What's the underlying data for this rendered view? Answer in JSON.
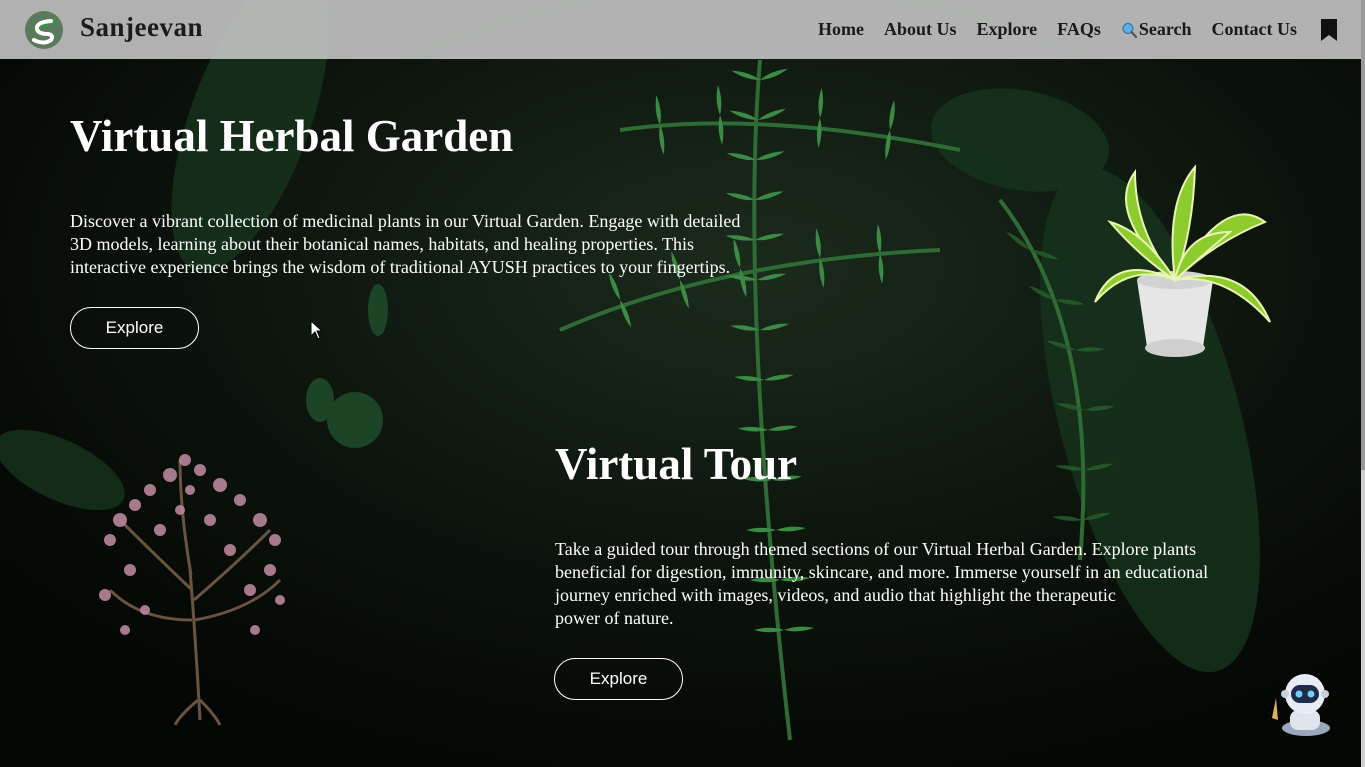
{
  "brand": {
    "name": "Sanjeevan",
    "logo_icon": "leaf-s-logo-icon"
  },
  "nav": {
    "home": "Home",
    "about": "About Us",
    "explore": "Explore",
    "faqs": "FAQs",
    "search": "Search",
    "contact": "Contact Us",
    "bookmark_icon": "bookmark-icon"
  },
  "hero": {
    "title": "Virtual Herbal Garden",
    "line1": "Discover a vibrant collection of medicinal plants in our Virtual Garden. Engage with detailed",
    "line2": "3D models, learning about their botanical names, habitats, and healing properties. This",
    "line3": "interactive experience brings the wisdom of traditional AYUSH practices to your fingertips.",
    "button": "Explore"
  },
  "tour": {
    "title": "Virtual Tour",
    "line1": "Take a guided tour through themed sections of our Virtual Herbal Garden. Explore plants",
    "line2": "beneficial for digestion, immunity, skincare, and more. Immerse yourself in an educational",
    "line3": "journey enriched with images, videos, and audio that highlight the therapeutic",
    "line4": "power of nature.",
    "button": "Explore"
  },
  "colors": {
    "navbar": "#cdcdcd",
    "background": "#060806",
    "fern": "#2f7a3a",
    "text": "#ffffff"
  }
}
